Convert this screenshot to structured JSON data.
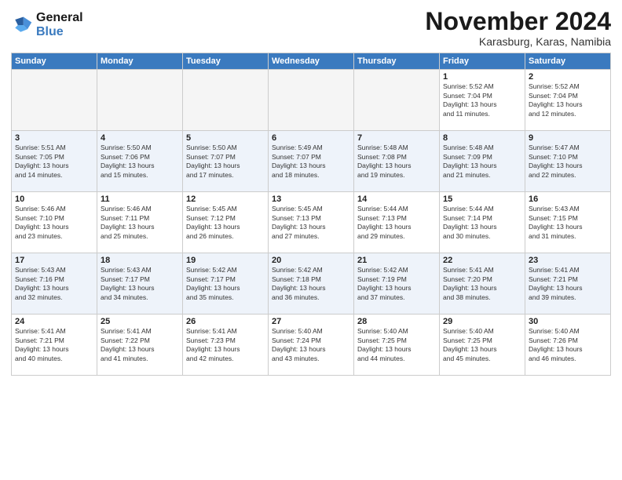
{
  "logo": {
    "line1": "General",
    "line2": "Blue"
  },
  "title": "November 2024",
  "location": "Karasburg, Karas, Namibia",
  "header": {
    "days": [
      "Sunday",
      "Monday",
      "Tuesday",
      "Wednesday",
      "Thursday",
      "Friday",
      "Saturday"
    ]
  },
  "weeks": [
    [
      {
        "day": "",
        "info": ""
      },
      {
        "day": "",
        "info": ""
      },
      {
        "day": "",
        "info": ""
      },
      {
        "day": "",
        "info": ""
      },
      {
        "day": "",
        "info": ""
      },
      {
        "day": "1",
        "info": "Sunrise: 5:52 AM\nSunset: 7:04 PM\nDaylight: 13 hours\nand 11 minutes."
      },
      {
        "day": "2",
        "info": "Sunrise: 5:52 AM\nSunset: 7:04 PM\nDaylight: 13 hours\nand 12 minutes."
      }
    ],
    [
      {
        "day": "3",
        "info": "Sunrise: 5:51 AM\nSunset: 7:05 PM\nDaylight: 13 hours\nand 14 minutes."
      },
      {
        "day": "4",
        "info": "Sunrise: 5:50 AM\nSunset: 7:06 PM\nDaylight: 13 hours\nand 15 minutes."
      },
      {
        "day": "5",
        "info": "Sunrise: 5:50 AM\nSunset: 7:07 PM\nDaylight: 13 hours\nand 17 minutes."
      },
      {
        "day": "6",
        "info": "Sunrise: 5:49 AM\nSunset: 7:07 PM\nDaylight: 13 hours\nand 18 minutes."
      },
      {
        "day": "7",
        "info": "Sunrise: 5:48 AM\nSunset: 7:08 PM\nDaylight: 13 hours\nand 19 minutes."
      },
      {
        "day": "8",
        "info": "Sunrise: 5:48 AM\nSunset: 7:09 PM\nDaylight: 13 hours\nand 21 minutes."
      },
      {
        "day": "9",
        "info": "Sunrise: 5:47 AM\nSunset: 7:10 PM\nDaylight: 13 hours\nand 22 minutes."
      }
    ],
    [
      {
        "day": "10",
        "info": "Sunrise: 5:46 AM\nSunset: 7:10 PM\nDaylight: 13 hours\nand 23 minutes."
      },
      {
        "day": "11",
        "info": "Sunrise: 5:46 AM\nSunset: 7:11 PM\nDaylight: 13 hours\nand 25 minutes."
      },
      {
        "day": "12",
        "info": "Sunrise: 5:45 AM\nSunset: 7:12 PM\nDaylight: 13 hours\nand 26 minutes."
      },
      {
        "day": "13",
        "info": "Sunrise: 5:45 AM\nSunset: 7:13 PM\nDaylight: 13 hours\nand 27 minutes."
      },
      {
        "day": "14",
        "info": "Sunrise: 5:44 AM\nSunset: 7:13 PM\nDaylight: 13 hours\nand 29 minutes."
      },
      {
        "day": "15",
        "info": "Sunrise: 5:44 AM\nSunset: 7:14 PM\nDaylight: 13 hours\nand 30 minutes."
      },
      {
        "day": "16",
        "info": "Sunrise: 5:43 AM\nSunset: 7:15 PM\nDaylight: 13 hours\nand 31 minutes."
      }
    ],
    [
      {
        "day": "17",
        "info": "Sunrise: 5:43 AM\nSunset: 7:16 PM\nDaylight: 13 hours\nand 32 minutes."
      },
      {
        "day": "18",
        "info": "Sunrise: 5:43 AM\nSunset: 7:17 PM\nDaylight: 13 hours\nand 34 minutes."
      },
      {
        "day": "19",
        "info": "Sunrise: 5:42 AM\nSunset: 7:17 PM\nDaylight: 13 hours\nand 35 minutes."
      },
      {
        "day": "20",
        "info": "Sunrise: 5:42 AM\nSunset: 7:18 PM\nDaylight: 13 hours\nand 36 minutes."
      },
      {
        "day": "21",
        "info": "Sunrise: 5:42 AM\nSunset: 7:19 PM\nDaylight: 13 hours\nand 37 minutes."
      },
      {
        "day": "22",
        "info": "Sunrise: 5:41 AM\nSunset: 7:20 PM\nDaylight: 13 hours\nand 38 minutes."
      },
      {
        "day": "23",
        "info": "Sunrise: 5:41 AM\nSunset: 7:21 PM\nDaylight: 13 hours\nand 39 minutes."
      }
    ],
    [
      {
        "day": "24",
        "info": "Sunrise: 5:41 AM\nSunset: 7:21 PM\nDaylight: 13 hours\nand 40 minutes."
      },
      {
        "day": "25",
        "info": "Sunrise: 5:41 AM\nSunset: 7:22 PM\nDaylight: 13 hours\nand 41 minutes."
      },
      {
        "day": "26",
        "info": "Sunrise: 5:41 AM\nSunset: 7:23 PM\nDaylight: 13 hours\nand 42 minutes."
      },
      {
        "day": "27",
        "info": "Sunrise: 5:40 AM\nSunset: 7:24 PM\nDaylight: 13 hours\nand 43 minutes."
      },
      {
        "day": "28",
        "info": "Sunrise: 5:40 AM\nSunset: 7:25 PM\nDaylight: 13 hours\nand 44 minutes."
      },
      {
        "day": "29",
        "info": "Sunrise: 5:40 AM\nSunset: 7:25 PM\nDaylight: 13 hours\nand 45 minutes."
      },
      {
        "day": "30",
        "info": "Sunrise: 5:40 AM\nSunset: 7:26 PM\nDaylight: 13 hours\nand 46 minutes."
      }
    ]
  ]
}
